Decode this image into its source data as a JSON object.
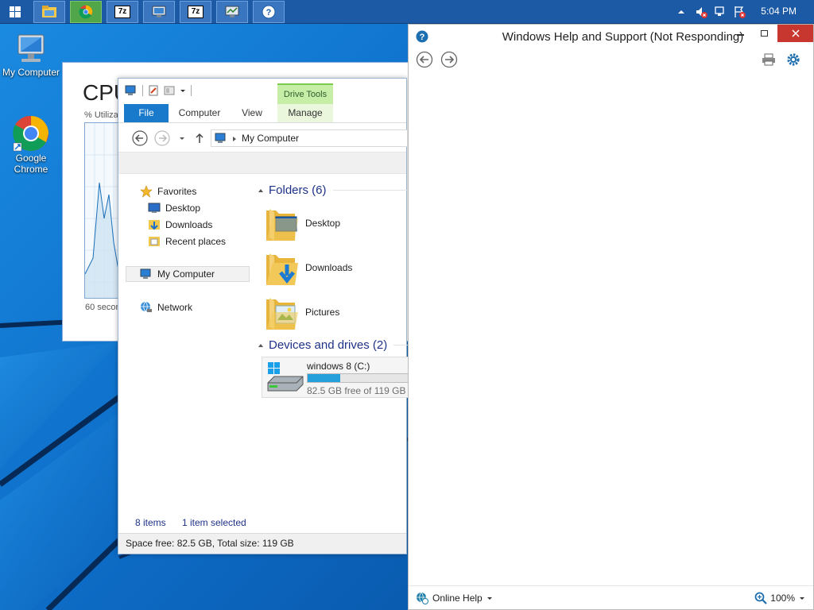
{
  "taskbar": {
    "clock": "5:04 PM",
    "buttons": [
      {
        "icon": "file-explorer-icon"
      },
      {
        "icon": "chrome-icon"
      },
      {
        "icon": "7zip-icon",
        "label": "7z"
      },
      {
        "icon": "remote-desktop-icon"
      },
      {
        "icon": "7zip-icon",
        "label": "7z"
      },
      {
        "icon": "network-monitor-icon"
      },
      {
        "icon": "help-icon"
      }
    ],
    "colors": {
      "bar": "#1c5aa6",
      "chrome_active": "#52a64a"
    }
  },
  "desktop": {
    "icons": [
      {
        "label": "My Computer",
        "icon": "computer-icon"
      },
      {
        "label": "Google Chrome",
        "icon": "chrome-icon"
      }
    ]
  },
  "taskmgr": {
    "title": "CPU",
    "subtitle": "% Utiliza",
    "footer": "60 secon"
  },
  "explorer": {
    "ribbon_context": "Drive Tools",
    "tabs": [
      "File",
      "Computer",
      "View",
      "Manage"
    ],
    "address": "My Computer",
    "nav": {
      "favorites": "Favorites",
      "desktop": "Desktop",
      "downloads": "Downloads",
      "recent": "Recent places",
      "my_computer": "My Computer",
      "network": "Network"
    },
    "folders_header": "Folders (6)",
    "folders": [
      {
        "name": "Desktop",
        "icon": "desktop-folder-icon"
      },
      {
        "name": "Downloads",
        "icon": "downloads-folder-icon"
      },
      {
        "name": "Pictures",
        "icon": "pictures-folder-icon"
      }
    ],
    "devices_header": "Devices and drives (2)",
    "drive": {
      "name": "windows 8 (C:)",
      "free_text": "82.5 GB free of 119 GB",
      "used_fraction": 0.31
    },
    "status_items": "8 items",
    "status_selected": "1 item selected",
    "details": "Space free: 82.5 GB, Total size: 119 GB",
    "accent": "#1979ca"
  },
  "help": {
    "title": "Windows Help and Support (Not Responding)",
    "online_help": "Online Help",
    "zoom": "100%",
    "accent": "#1e6fb0"
  }
}
